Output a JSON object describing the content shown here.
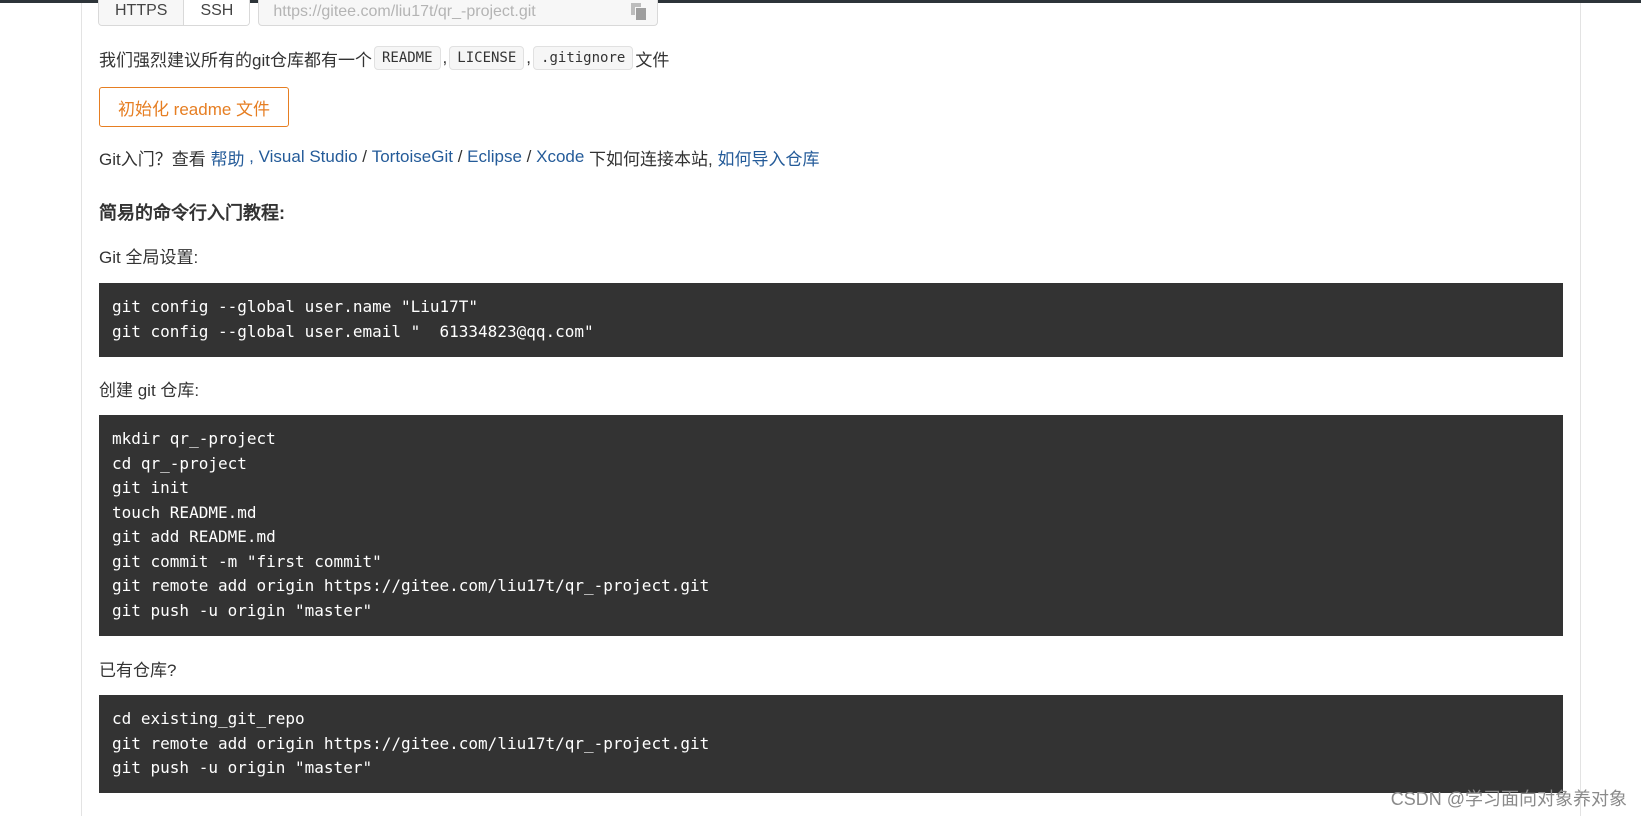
{
  "clone": {
    "protocols": [
      "HTTPS",
      "SSH"
    ],
    "url": "https://gitee.com/liu17t/qr_-project.git"
  },
  "recommend": {
    "prefix": "我们强烈建议所有的git仓库都有一个",
    "files": [
      "README",
      "LICENSE",
      ".gitignore"
    ],
    "separator": ",",
    "suffix": "文件"
  },
  "init_button": "初始化 readme 文件",
  "help": {
    "prefix": "Git入门？查看 ",
    "help_link": "帮助",
    "sep1": " , ",
    "vs_link": "Visual Studio",
    "sep2": " / ",
    "tortoise_link": "TortoiseGit",
    "sep3": " / ",
    "eclipse_link": "Eclipse",
    "sep4": " / ",
    "xcode_link": "Xcode",
    "middle": " 下如何连接本站, ",
    "import_link": "如何导入仓库"
  },
  "tutorial_title": "简易的命令行入门教程:",
  "global_label": "Git 全局设置:",
  "global_lines": [
    "git config --global user.name \"Liu17T\"",
    "git config --global user.email \"  61334823@qq.com\""
  ],
  "create_label": "创建 git 仓库:",
  "create_lines": [
    "mkdir qr_-project",
    "cd qr_-project",
    "git init",
    "touch README.md",
    "git add README.md",
    "git commit -m \"first commit\"",
    "git remote add origin https://gitee.com/liu17t/qr_-project.git",
    "git push -u origin \"master\""
  ],
  "existing_label": "已有仓库?",
  "existing_lines": [
    "cd existing_git_repo",
    "git remote add origin https://gitee.com/liu17t/qr_-project.git",
    "git push -u origin \"master\""
  ],
  "watermark": "CSDN @学习面向对象养对象"
}
